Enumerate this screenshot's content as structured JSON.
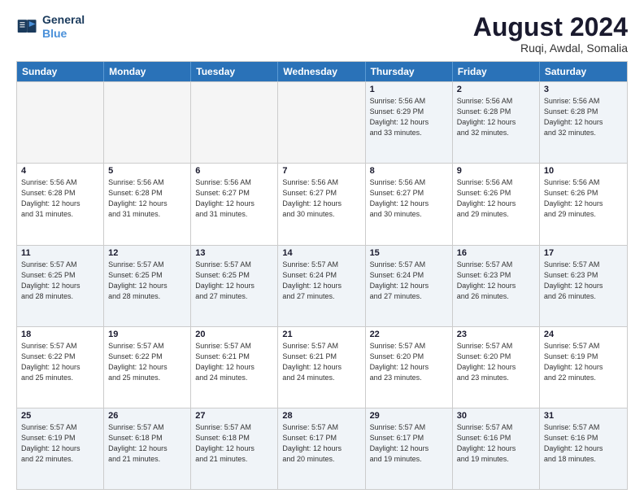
{
  "logo": {
    "line1": "General",
    "line2": "Blue"
  },
  "title": "August 2024",
  "location": "Ruqi, Awdal, Somalia",
  "days_header": [
    "Sunday",
    "Monday",
    "Tuesday",
    "Wednesday",
    "Thursday",
    "Friday",
    "Saturday"
  ],
  "weeks": [
    [
      {
        "day": "",
        "info": ""
      },
      {
        "day": "",
        "info": ""
      },
      {
        "day": "",
        "info": ""
      },
      {
        "day": "",
        "info": ""
      },
      {
        "day": "1",
        "info": "Sunrise: 5:56 AM\nSunset: 6:29 PM\nDaylight: 12 hours\nand 33 minutes."
      },
      {
        "day": "2",
        "info": "Sunrise: 5:56 AM\nSunset: 6:28 PM\nDaylight: 12 hours\nand 32 minutes."
      },
      {
        "day": "3",
        "info": "Sunrise: 5:56 AM\nSunset: 6:28 PM\nDaylight: 12 hours\nand 32 minutes."
      }
    ],
    [
      {
        "day": "4",
        "info": "Sunrise: 5:56 AM\nSunset: 6:28 PM\nDaylight: 12 hours\nand 31 minutes."
      },
      {
        "day": "5",
        "info": "Sunrise: 5:56 AM\nSunset: 6:28 PM\nDaylight: 12 hours\nand 31 minutes."
      },
      {
        "day": "6",
        "info": "Sunrise: 5:56 AM\nSunset: 6:27 PM\nDaylight: 12 hours\nand 31 minutes."
      },
      {
        "day": "7",
        "info": "Sunrise: 5:56 AM\nSunset: 6:27 PM\nDaylight: 12 hours\nand 30 minutes."
      },
      {
        "day": "8",
        "info": "Sunrise: 5:56 AM\nSunset: 6:27 PM\nDaylight: 12 hours\nand 30 minutes."
      },
      {
        "day": "9",
        "info": "Sunrise: 5:56 AM\nSunset: 6:26 PM\nDaylight: 12 hours\nand 29 minutes."
      },
      {
        "day": "10",
        "info": "Sunrise: 5:56 AM\nSunset: 6:26 PM\nDaylight: 12 hours\nand 29 minutes."
      }
    ],
    [
      {
        "day": "11",
        "info": "Sunrise: 5:57 AM\nSunset: 6:25 PM\nDaylight: 12 hours\nand 28 minutes."
      },
      {
        "day": "12",
        "info": "Sunrise: 5:57 AM\nSunset: 6:25 PM\nDaylight: 12 hours\nand 28 minutes."
      },
      {
        "day": "13",
        "info": "Sunrise: 5:57 AM\nSunset: 6:25 PM\nDaylight: 12 hours\nand 27 minutes."
      },
      {
        "day": "14",
        "info": "Sunrise: 5:57 AM\nSunset: 6:24 PM\nDaylight: 12 hours\nand 27 minutes."
      },
      {
        "day": "15",
        "info": "Sunrise: 5:57 AM\nSunset: 6:24 PM\nDaylight: 12 hours\nand 27 minutes."
      },
      {
        "day": "16",
        "info": "Sunrise: 5:57 AM\nSunset: 6:23 PM\nDaylight: 12 hours\nand 26 minutes."
      },
      {
        "day": "17",
        "info": "Sunrise: 5:57 AM\nSunset: 6:23 PM\nDaylight: 12 hours\nand 26 minutes."
      }
    ],
    [
      {
        "day": "18",
        "info": "Sunrise: 5:57 AM\nSunset: 6:22 PM\nDaylight: 12 hours\nand 25 minutes."
      },
      {
        "day": "19",
        "info": "Sunrise: 5:57 AM\nSunset: 6:22 PM\nDaylight: 12 hours\nand 25 minutes."
      },
      {
        "day": "20",
        "info": "Sunrise: 5:57 AM\nSunset: 6:21 PM\nDaylight: 12 hours\nand 24 minutes."
      },
      {
        "day": "21",
        "info": "Sunrise: 5:57 AM\nSunset: 6:21 PM\nDaylight: 12 hours\nand 24 minutes."
      },
      {
        "day": "22",
        "info": "Sunrise: 5:57 AM\nSunset: 6:20 PM\nDaylight: 12 hours\nand 23 minutes."
      },
      {
        "day": "23",
        "info": "Sunrise: 5:57 AM\nSunset: 6:20 PM\nDaylight: 12 hours\nand 23 minutes."
      },
      {
        "day": "24",
        "info": "Sunrise: 5:57 AM\nSunset: 6:19 PM\nDaylight: 12 hours\nand 22 minutes."
      }
    ],
    [
      {
        "day": "25",
        "info": "Sunrise: 5:57 AM\nSunset: 6:19 PM\nDaylight: 12 hours\nand 22 minutes."
      },
      {
        "day": "26",
        "info": "Sunrise: 5:57 AM\nSunset: 6:18 PM\nDaylight: 12 hours\nand 21 minutes."
      },
      {
        "day": "27",
        "info": "Sunrise: 5:57 AM\nSunset: 6:18 PM\nDaylight: 12 hours\nand 21 minutes."
      },
      {
        "day": "28",
        "info": "Sunrise: 5:57 AM\nSunset: 6:17 PM\nDaylight: 12 hours\nand 20 minutes."
      },
      {
        "day": "29",
        "info": "Sunrise: 5:57 AM\nSunset: 6:17 PM\nDaylight: 12 hours\nand 19 minutes."
      },
      {
        "day": "30",
        "info": "Sunrise: 5:57 AM\nSunset: 6:16 PM\nDaylight: 12 hours\nand 19 minutes."
      },
      {
        "day": "31",
        "info": "Sunrise: 5:57 AM\nSunset: 6:16 PM\nDaylight: 12 hours\nand 18 minutes."
      }
    ]
  ]
}
